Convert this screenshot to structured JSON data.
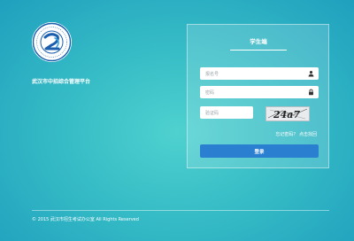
{
  "brand": {
    "site_name": "武汉市中招综合管理平台",
    "logo_icon": "zhaokao-logo-icon"
  },
  "login": {
    "tab_title": "学生端",
    "username_placeholder": "报名号",
    "password_placeholder": "密码",
    "captcha_placeholder": "验证码",
    "captcha_text": "24a7",
    "forgot_text": "忘记密码？",
    "retrieve_link": "点击找回",
    "login_button": "登录",
    "user_icon": "user-icon",
    "lock_icon": "lock-icon"
  },
  "footer": {
    "copyright": "© 2015 武汉市招生考试办公室 All Rights Reserved"
  },
  "colors": {
    "button": "#2b7fd1",
    "background_start": "#4fd1cf",
    "background_end": "#1fa0be"
  }
}
